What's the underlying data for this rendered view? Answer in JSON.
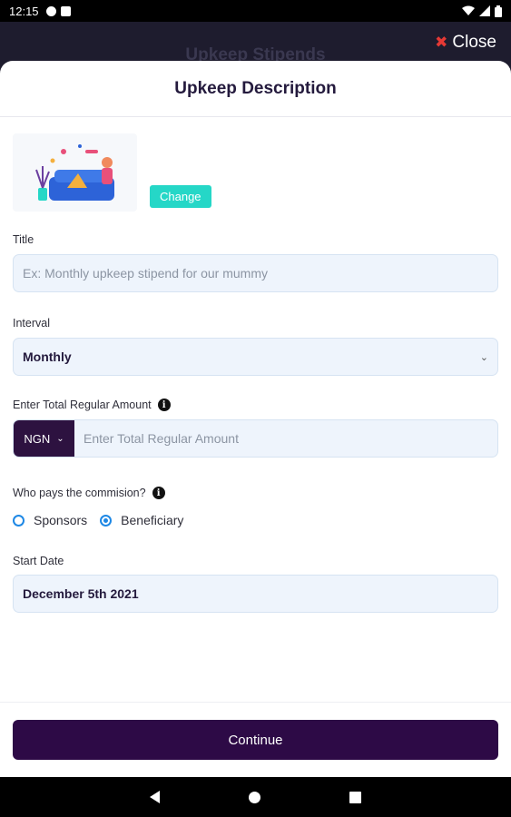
{
  "status_bar": {
    "time": "12:15"
  },
  "backdrop": {
    "title": "Upkeep Stipends",
    "close_label": "Close"
  },
  "sheet": {
    "title": "Upkeep Description"
  },
  "image": {
    "change_label": "Change"
  },
  "title_field": {
    "label": "Title",
    "placeholder": "Ex: Monthly upkeep stipend for our mummy"
  },
  "interval_field": {
    "label": "Interval",
    "value": "Monthly"
  },
  "amount_field": {
    "label": "Enter Total Regular Amount",
    "currency": "NGN",
    "placeholder": "Enter Total Regular Amount"
  },
  "commission": {
    "label": "Who pays the commision?",
    "options": [
      "Sponsors",
      "Beneficiary"
    ],
    "selected": "Beneficiary"
  },
  "start_date": {
    "label": "Start Date",
    "value": "December 5th 2021"
  },
  "continue_label": "Continue",
  "colors": {
    "primary": "#2d0a46",
    "accent": "#25d7c7",
    "field_bg": "#eef4fc",
    "radio": "#1e88e5",
    "close_x": "#e53935"
  }
}
